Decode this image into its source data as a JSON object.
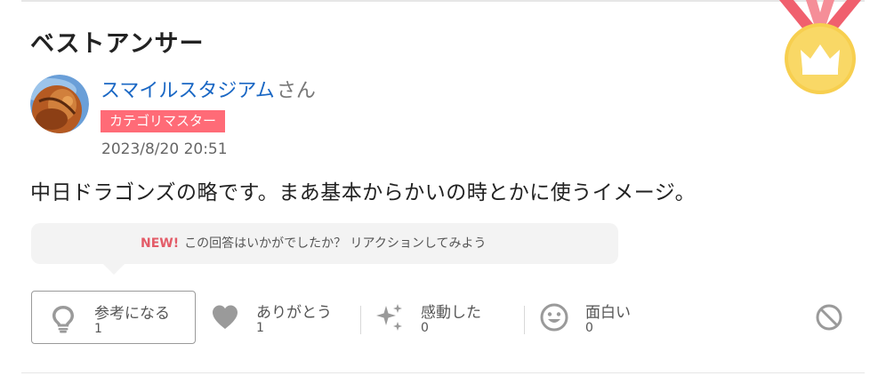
{
  "section": {
    "title": "ベストアンサー"
  },
  "author": {
    "name": "スマイルスタジアム",
    "honorific": "さん",
    "badge": "カテゴリマスター",
    "timestamp": "2023/8/20 20:51"
  },
  "answer": {
    "text": "中日ドラゴンズの略です。まあ基本からかいの時とかに使うイメージ。"
  },
  "prompt": {
    "new_label": "NEW!",
    "text": "この回答はいかがでしたか？ リアクションしてみよう"
  },
  "reactions": [
    {
      "label": "参考になる",
      "count": "1",
      "icon": "lightbulb-icon",
      "selected": true
    },
    {
      "label": "ありがとう",
      "count": "1",
      "icon": "heart-icon",
      "selected": false
    },
    {
      "label": "感動した",
      "count": "0",
      "icon": "sparkle-icon",
      "selected": false
    },
    {
      "label": "面白い",
      "count": "0",
      "icon": "smile-icon",
      "selected": false
    }
  ],
  "colors": {
    "link": "#1a67c4",
    "badge": "#ff6b77",
    "new_label": "#e35c68",
    "medal_gold": "#f7cf4f",
    "ribbon": "#f0606e",
    "icon_gray": "#9a9a9a"
  }
}
